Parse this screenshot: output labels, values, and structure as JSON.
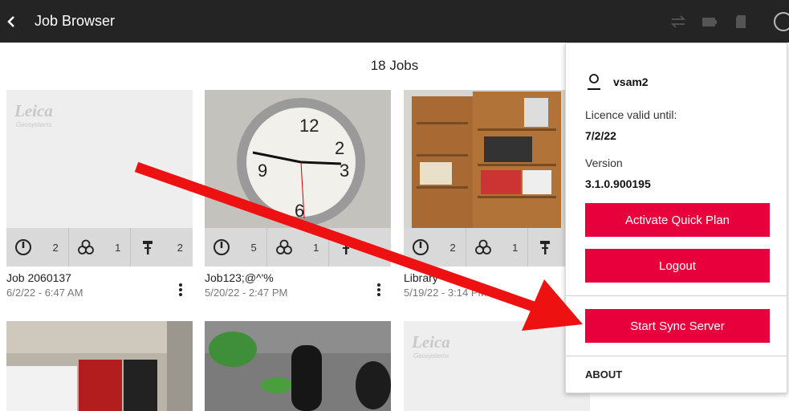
{
  "header": {
    "title": "Job Browser",
    "back_icon": "chevron-left-icon"
  },
  "status_icons": [
    "sync-icon",
    "battery-icon",
    "sd-card-icon",
    "info-icon"
  ],
  "job_count": "18 Jobs",
  "jobs": [
    {
      "name": "Job 2060137",
      "date": "6/2/22 - 6:47 AM",
      "stats": [
        "2",
        "1",
        "2"
      ],
      "thumbnail": "leica-logo"
    },
    {
      "name": "Job123;@^'%",
      "date": "5/20/22 - 2:47 PM",
      "stats": [
        "5",
        "1",
        ""
      ],
      "thumbnail": "wall-clock-photo"
    },
    {
      "name": "Library",
      "date": "5/19/22 - 3:14 PM",
      "stats": [
        "2",
        "1",
        ""
      ],
      "thumbnail": "bookshelf-photo"
    },
    {
      "name": "",
      "date": "",
      "thumbnail": "office-vending-photo"
    },
    {
      "name": "",
      "date": "",
      "thumbnail": "scanner-plant-photo"
    },
    {
      "name": "",
      "date": "",
      "thumbnail": "leica-logo"
    }
  ],
  "logo": {
    "brand": "Leica",
    "sub": "Geosystems"
  },
  "popup": {
    "username": "vsam2",
    "licence_label": "Licence valid until:",
    "licence_value": "7/2/22",
    "version_label": "Version",
    "version_value": "3.1.0.900195",
    "activate_label": "Activate Quick Plan",
    "logout_label": "Logout",
    "sync_label": "Start Sync Server",
    "about_label": "ABOUT"
  },
  "colors": {
    "accent": "#e8003d",
    "topbar": "#242424",
    "annotation_arrow": "#ee1111"
  }
}
